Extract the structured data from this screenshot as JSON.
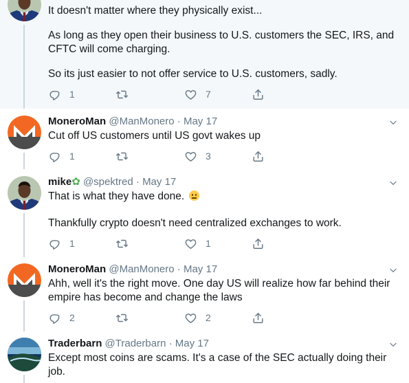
{
  "colors": {
    "accent": "#1da1f2",
    "muted": "#657786",
    "highlight_bg": "#f5f8fa",
    "monero_orange": "#f26822",
    "monero_gray": "#4c4c4c"
  },
  "icons": [
    "reply-icon",
    "retweet-icon",
    "like-icon",
    "share-icon",
    "chevron-down-icon"
  ],
  "tweets": [
    {
      "name": "",
      "handle": "",
      "date": "",
      "lines": [
        "It doesn't matter where they physically exist...",
        "As long as they open their business to U.S. customers the SEC, IRS, and",
        "CFTC will come charging.",
        "So its just easier to not offer service to U.S. customers,  sadly."
      ],
      "replies": "1",
      "retweets": "",
      "likes": "7"
    },
    {
      "name": "MoneroMan",
      "handle": "@ManMonero",
      "date": "May 17",
      "lines": [
        "Cut off US customers until US govt wakes up"
      ],
      "replies": "1",
      "retweets": "",
      "likes": "3"
    },
    {
      "name": "mike",
      "handle": "@spektred",
      "date": "May 17",
      "lines": [
        "That is what they have done.",
        "Thankfully crypto doesn't need centralized exchanges to work."
      ],
      "replies": "1",
      "retweets": "",
      "likes": "1"
    },
    {
      "name": "MoneroMan",
      "handle": "@ManMonero",
      "date": "May 17",
      "lines": [
        "Ahh, well it's the right move. One day US will realize how far behind their",
        "empire has become and change the laws"
      ],
      "replies": "2",
      "retweets": "",
      "likes": "2"
    },
    {
      "name": "Traderbarn",
      "handle": "@Traderbarn",
      "date": "May 17",
      "lines": [
        "Except most coins are scams. It's a case of the SEC actually doing their",
        "job."
      ],
      "replies": "",
      "retweets": "",
      "likes": ""
    }
  ],
  "separator": "·"
}
